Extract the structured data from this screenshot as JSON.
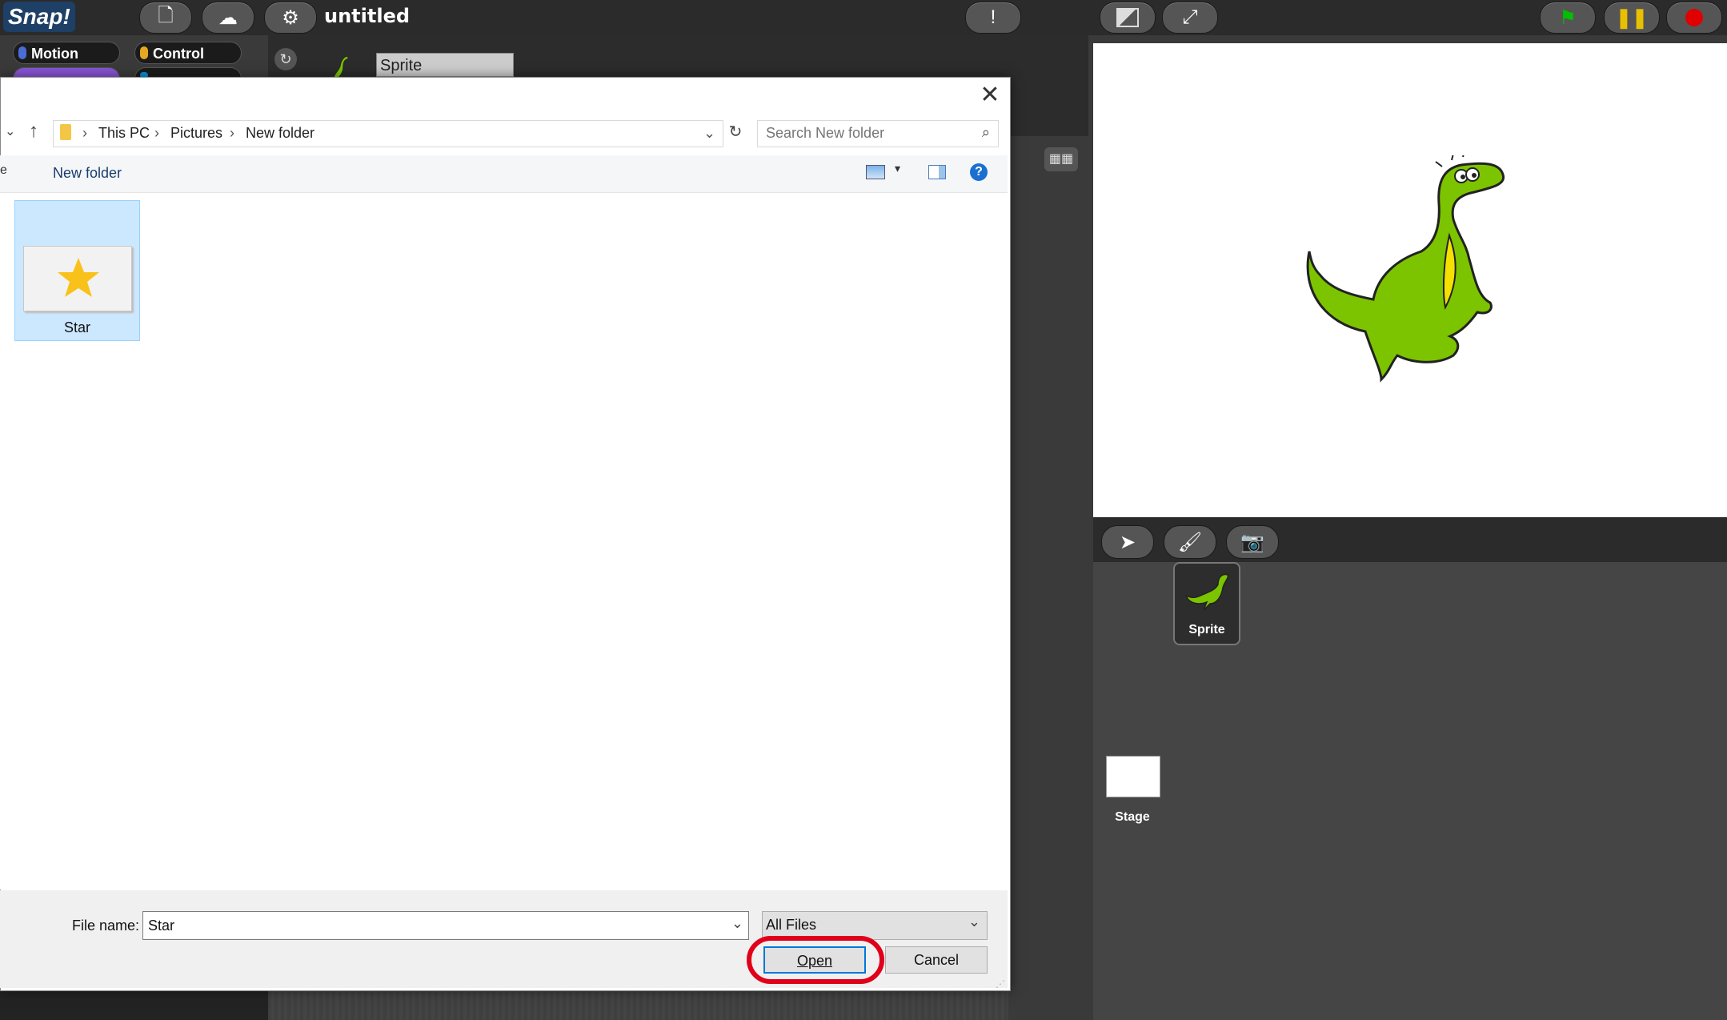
{
  "snap": {
    "logo": "Snap!",
    "project_title": "untitled",
    "categories": [
      "Motion",
      "Control"
    ],
    "category_colors": {
      "motion": "#4a6cd4",
      "control": "#e6a822",
      "looks": "#8a55d7",
      "sensing": "#0494dc"
    },
    "sprite_name": "Sprite",
    "sprite_tile_label": "Sprite",
    "stage_label": "Stage",
    "accent": {
      "green_flag": "#00c000",
      "pause": "#e8c000",
      "stop": "#e00000"
    }
  },
  "dialog": {
    "breadcrumbs": [
      "This PC",
      "Pictures",
      "New folder"
    ],
    "search_placeholder": "Search New folder",
    "new_folder_label": "New folder",
    "organize_stub": "e",
    "files": [
      {
        "name": "Star",
        "selected": true
      }
    ],
    "file_name_label": "File name:",
    "file_name_value": "Star",
    "filter_value": "All Files",
    "open_label": "Open",
    "cancel_label": "Cancel",
    "help_label": "?"
  }
}
